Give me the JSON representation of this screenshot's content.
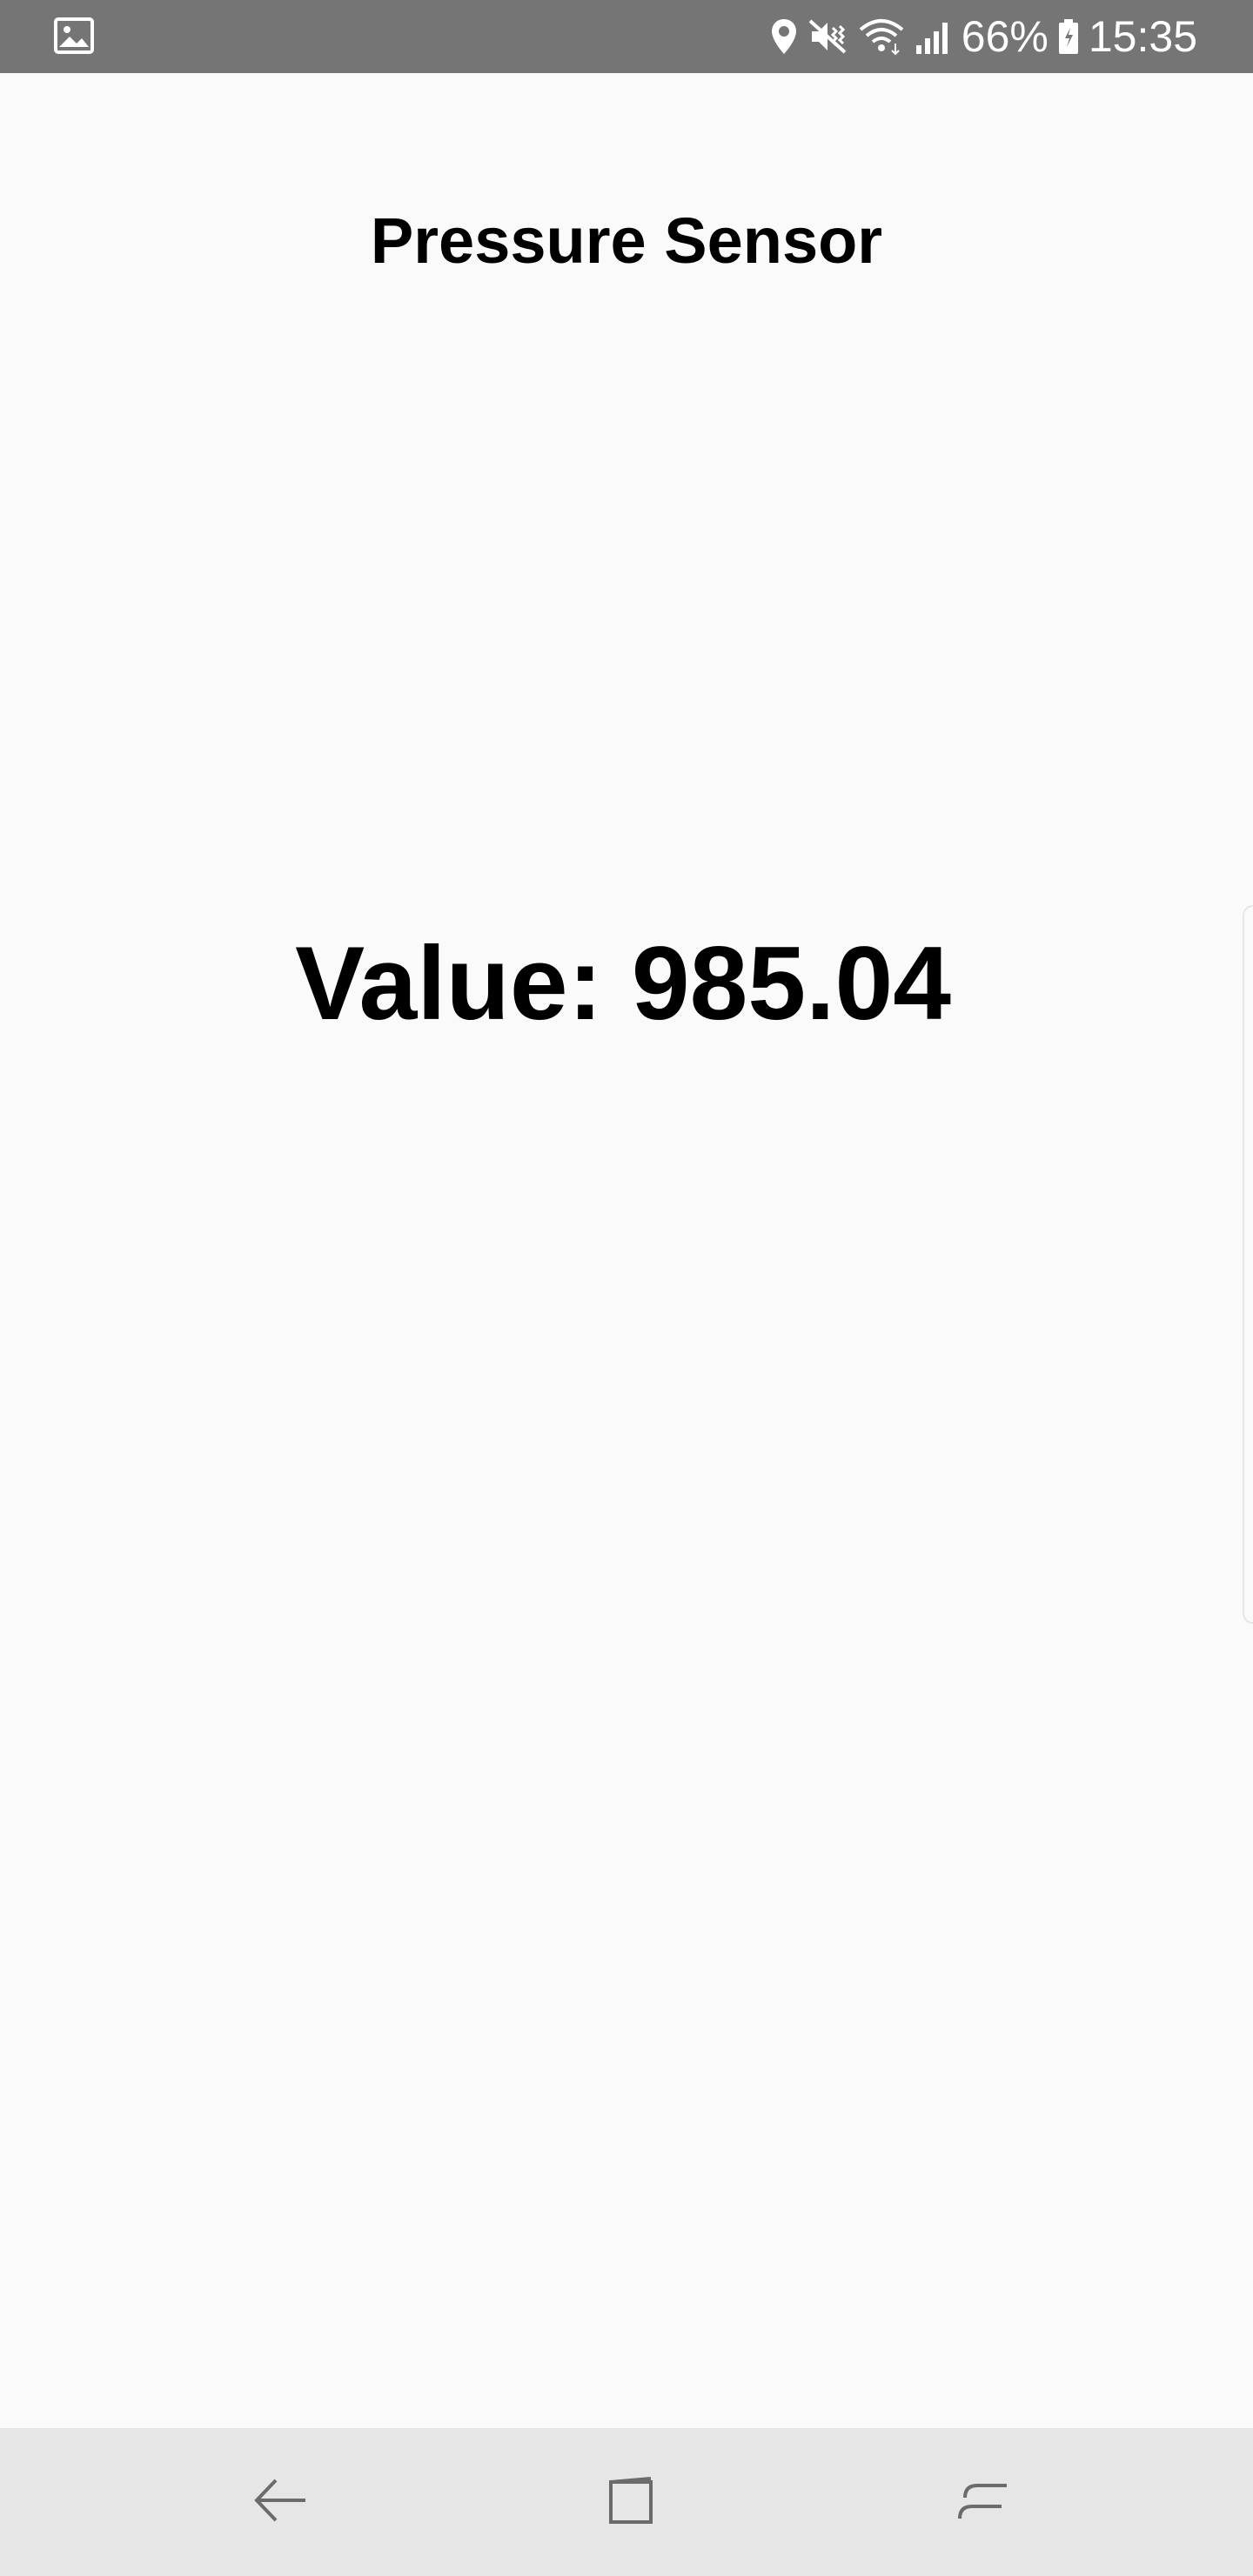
{
  "status_bar": {
    "left_icon": "image-notification-icon",
    "icons": [
      "location-icon",
      "vibrate-mute-icon",
      "wifi-icon",
      "signal-icon"
    ],
    "battery_percent": "66%",
    "battery_icon": "battery-charging-icon",
    "time": "15:35",
    "background_color": "#757575"
  },
  "screen": {
    "title": "Pressure Sensor",
    "value_text": "Value: 985.04",
    "background_color": "#fafafa"
  },
  "nav_bar": {
    "buttons": [
      "back-icon",
      "home-icon",
      "recents-icon"
    ],
    "background_color": "#e6e6e6"
  }
}
